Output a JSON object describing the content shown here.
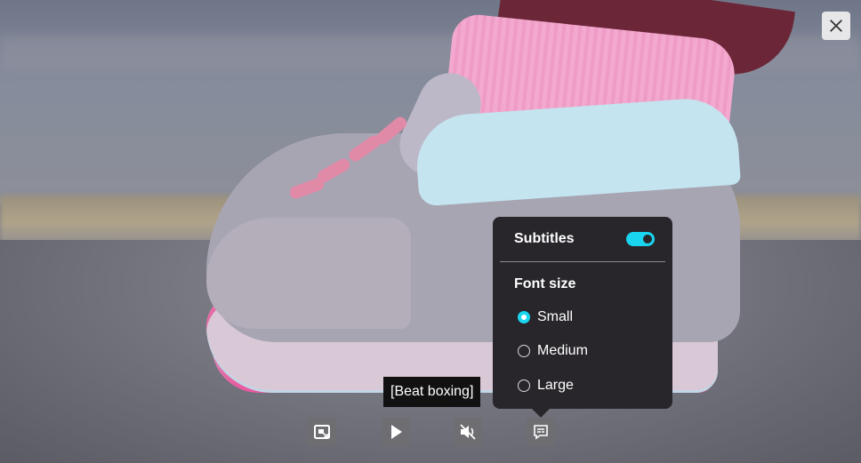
{
  "caption": "[Beat boxing]",
  "subtitles_panel": {
    "subtitles_label": "Subtitles",
    "subtitles_enabled": true,
    "font_size_label": "Font size",
    "font_size_options": [
      "Small",
      "Medium",
      "Large"
    ],
    "selected_font_size": "Small"
  },
  "controls": {
    "icons": [
      "picture-in-picture-icon",
      "play-icon",
      "muted-volume-icon",
      "subtitles-icon",
      "close-icon"
    ]
  },
  "colors": {
    "accent": "#1ad5f0",
    "panel": "#28262b"
  }
}
